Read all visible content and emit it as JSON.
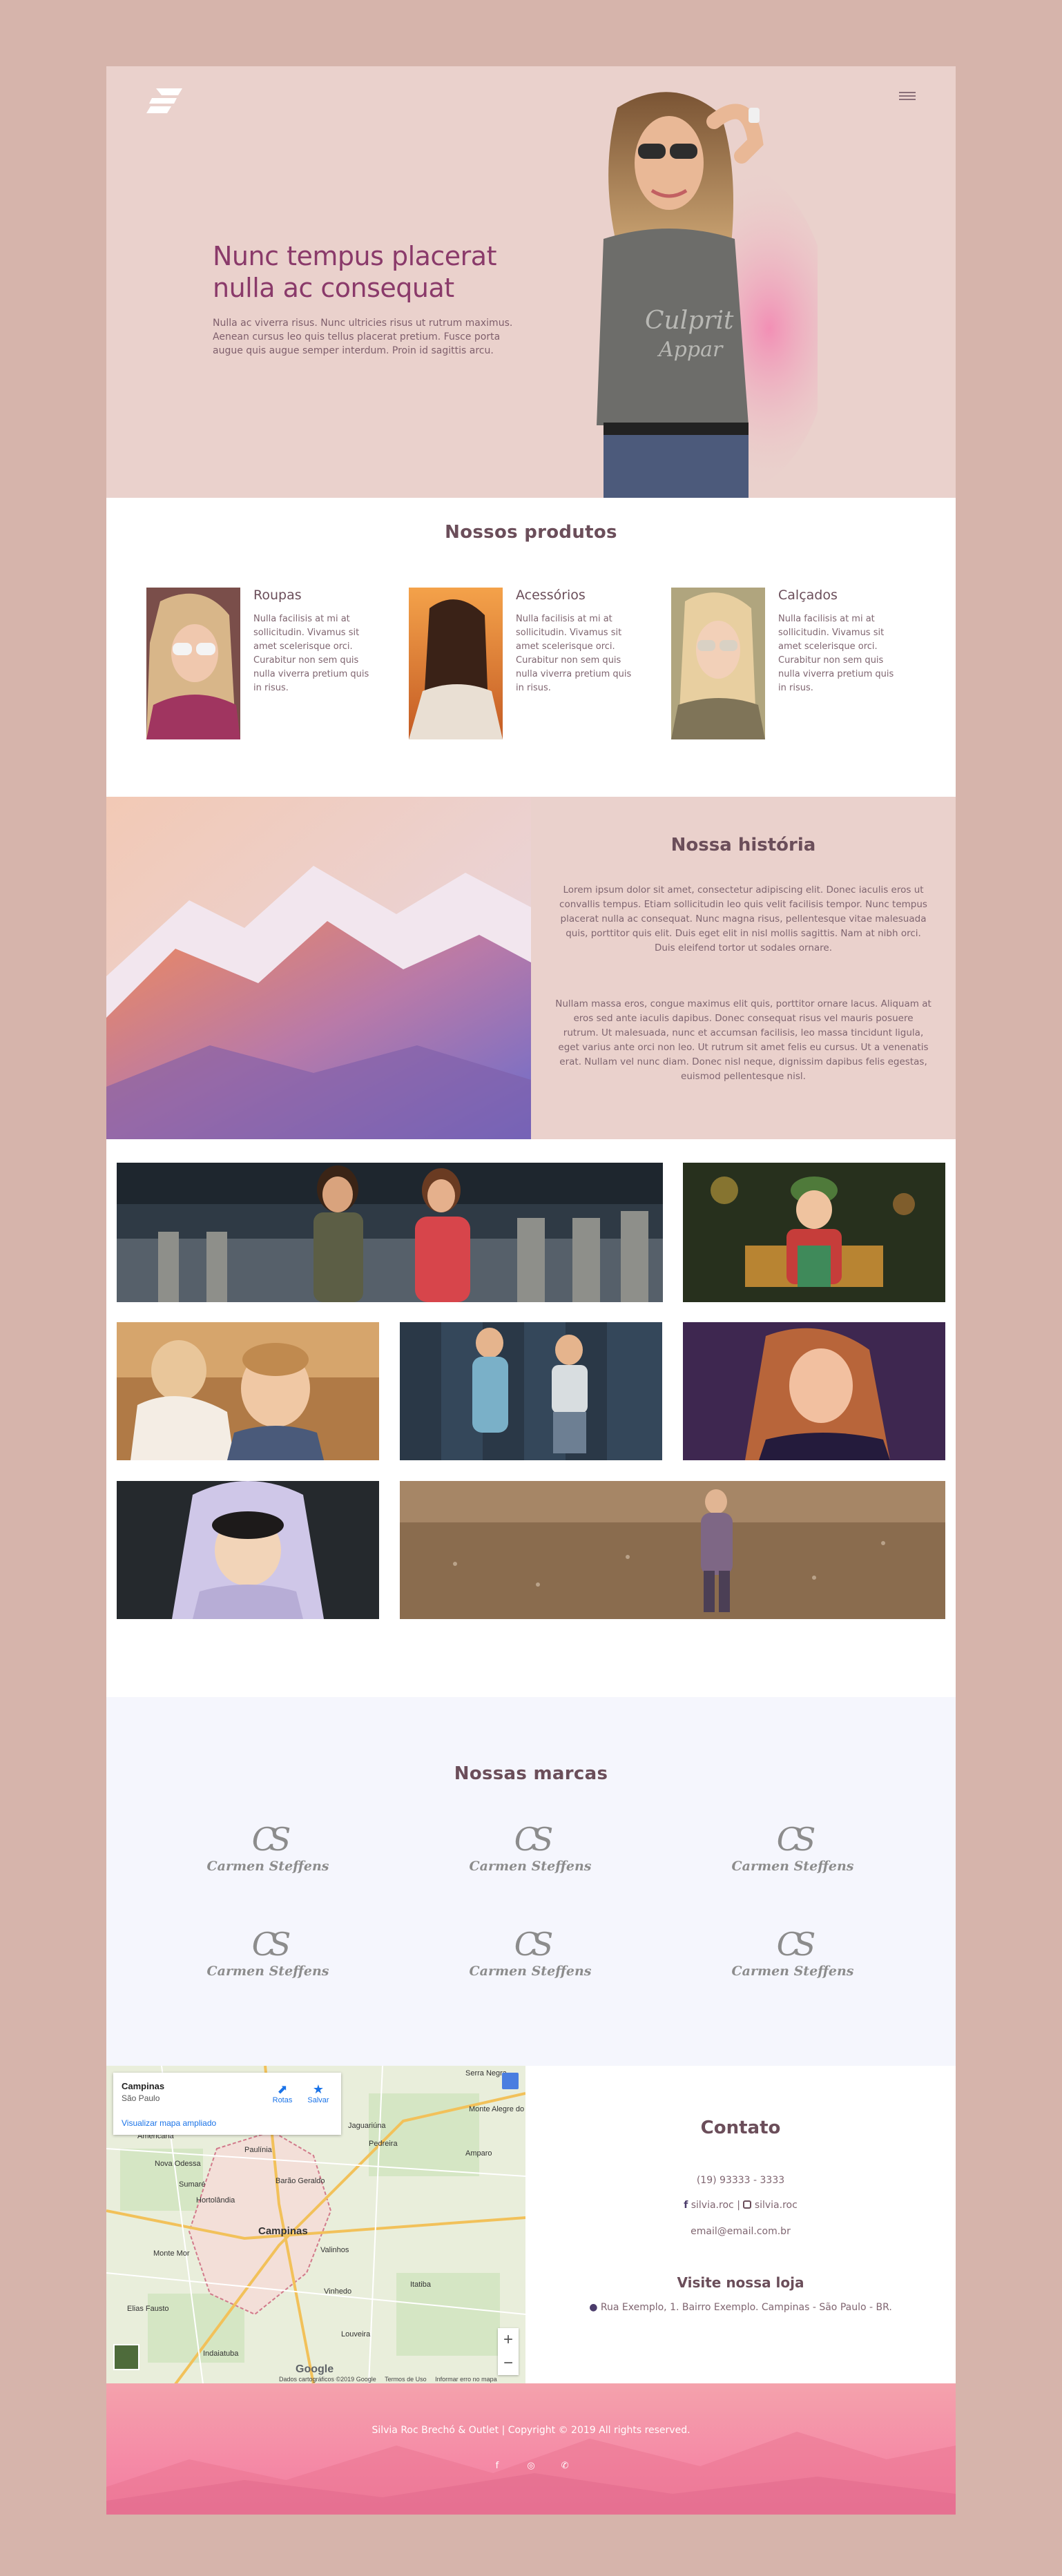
{
  "hero": {
    "title": "Nunc tempus placerat nulla ac consequat",
    "text": "Nulla ac viverra risus. Nunc ultricies risus ut rutrum maximus. Aenean cursus leo quis tellus placerat pretium. Fusce porta augue quis augue semper interdum. Proin id sagittis arcu."
  },
  "products": {
    "title": "Nossos produtos",
    "items": [
      {
        "name": "Roupas",
        "desc": "Nulla facilisis at mi at sollicitudin. Vivamus sit amet scelerisque orci. Curabitur non sem quis nulla viverra pretium quis in risus."
      },
      {
        "name": "Acessórios",
        "desc": "Nulla facilisis at mi at sollicitudin. Vivamus sit amet scelerisque orci. Curabitur non sem quis nulla viverra pretium quis in risus."
      },
      {
        "name": "Calçados",
        "desc": "Nulla facilisis at mi at sollicitudin. Vivamus sit amet scelerisque orci. Curabitur non sem quis nulla viverra pretium quis in risus."
      }
    ]
  },
  "history": {
    "title": "Nossa história",
    "p1": "Lorem ipsum dolor sit amet, consectetur adipiscing elit. Donec iaculis eros ut convallis tempus. Etiam sollicitudin leo quis velit facilisis tempor. Nunc tempus placerat nulla ac consequat. Nunc magna risus, pellentesque vitae malesuada quis, porttitor quis elit. Duis eget elit in nisl mollis sagittis. Nam at nibh orci. Duis eleifend tortor ut sodales ornare.",
    "p2": "Nullam massa eros, congue maximus elit quis, porttitor ornare lacus. Aliquam at eros sed ante iaculis dapibus. Donec consequat risus vel mauris posuere rutrum. Ut malesuada, nunc et accumsan facilisis, leo massa tincidunt ligula, eget varius ante orci non leo. Ut rutrum sit amet felis eu cursus. Ut a venenatis erat. Nullam vel nunc diam. Donec nisl neque, dignissim dapibus felis egestas, euismod pellentesque nisl."
  },
  "brands": {
    "title": "Nossas marcas",
    "items": [
      {
        "mono": "CS",
        "name": "Carmen Steffens"
      },
      {
        "mono": "CS",
        "name": "Carmen Steffens"
      },
      {
        "mono": "CS",
        "name": "Carmen Steffens"
      },
      {
        "mono": "CS",
        "name": "Carmen Steffens"
      },
      {
        "mono": "CS",
        "name": "Carmen Steffens"
      },
      {
        "mono": "CS",
        "name": "Carmen Steffens"
      }
    ]
  },
  "map": {
    "place": "Campinas",
    "region": "São Paulo",
    "routes": "Rotas",
    "save": "Salvar",
    "bigger": "Visualizar mapa ampliado",
    "zoom_in": "+",
    "zoom_out": "−",
    "google": "Google",
    "footer_data": "Dados cartográficos ©2019 Google",
    "footer_terms": "Termos de Uso",
    "footer_report": "Informar erro no mapa",
    "labels": [
      "Campinas",
      "Sumaré",
      "Hortolândia",
      "Nova Odessa",
      "Americana",
      "Paulínia",
      "Valinhos",
      "Vinhedo",
      "Itatiba",
      "Jaguariúna",
      "Pedreira",
      "Amparo",
      "Monte Alegre do Sul",
      "Serra Negra",
      "Indaiatuba",
      "Louveira",
      "Monte Mor",
      "Elias Fausto",
      "Barão Geraldo"
    ]
  },
  "contact": {
    "title": "Contato",
    "phone": "(19) 93333 - 3333",
    "facebook": "silvia.roc",
    "separator": "|",
    "instagram": "silvia.roc",
    "email": "email@email.com.br",
    "visit_title": "Visite nossa loja",
    "address": "Rua Exemplo, 1. Bairro Exemplo. Campinas - São Paulo - BR."
  },
  "footer": {
    "copyright": "Silvia Roc Brechó & Outlet | Copyright © 2019 All rights reserved."
  },
  "icons": {
    "facebook": "facebook-icon",
    "instagram": "instagram-icon",
    "whatsapp": "whatsapp-icon",
    "menu": "hamburger-icon"
  },
  "colors": {
    "hero_bg": "#ead1cc",
    "accent": "#8a3a6a",
    "page_bg": "#d6b4ab",
    "brands_bg": "#f5f6fd",
    "footer_pink": "#f58aa6"
  }
}
